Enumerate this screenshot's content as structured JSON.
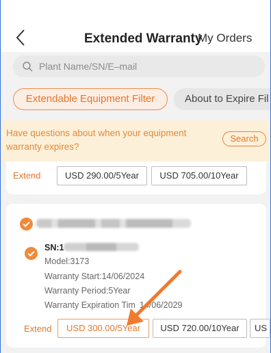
{
  "header": {
    "title": "Extended Warranty",
    "my_orders_label": "My Orders"
  },
  "search": {
    "placeholder": "Plant Name/SN/E–mail"
  },
  "filters": {
    "active_label": "Extendable Equipment Filter",
    "inactive_label": "About to Expire Fil"
  },
  "banner": {
    "text": "Have questions about when your equipment warranty expires?",
    "button_label": "Search"
  },
  "cards": [
    {
      "extend_label": "Extend",
      "prices": [
        "USD 290.00/5Year",
        "USD 705.00/10Year"
      ]
    },
    {
      "sn_label": "SN:1",
      "model_line": "Model:3173",
      "start_line": "Warranty Start:14/06/2024",
      "period_line": "Warranty Period:5Year",
      "expiration_line": "Warranty Expiration Tim",
      "expiration_date": "14/06/2029",
      "extend_label": "Extend",
      "prices": [
        "USD 300.00/5Year",
        "USD 720.00/10Year",
        "US"
      ],
      "selected_price_index": 0
    }
  ],
  "colors": {
    "accent": "#e5762b",
    "accent_bg": "#fdeee4",
    "banner_bg": "#fdf0d9",
    "arrow": "#f07a2d"
  }
}
